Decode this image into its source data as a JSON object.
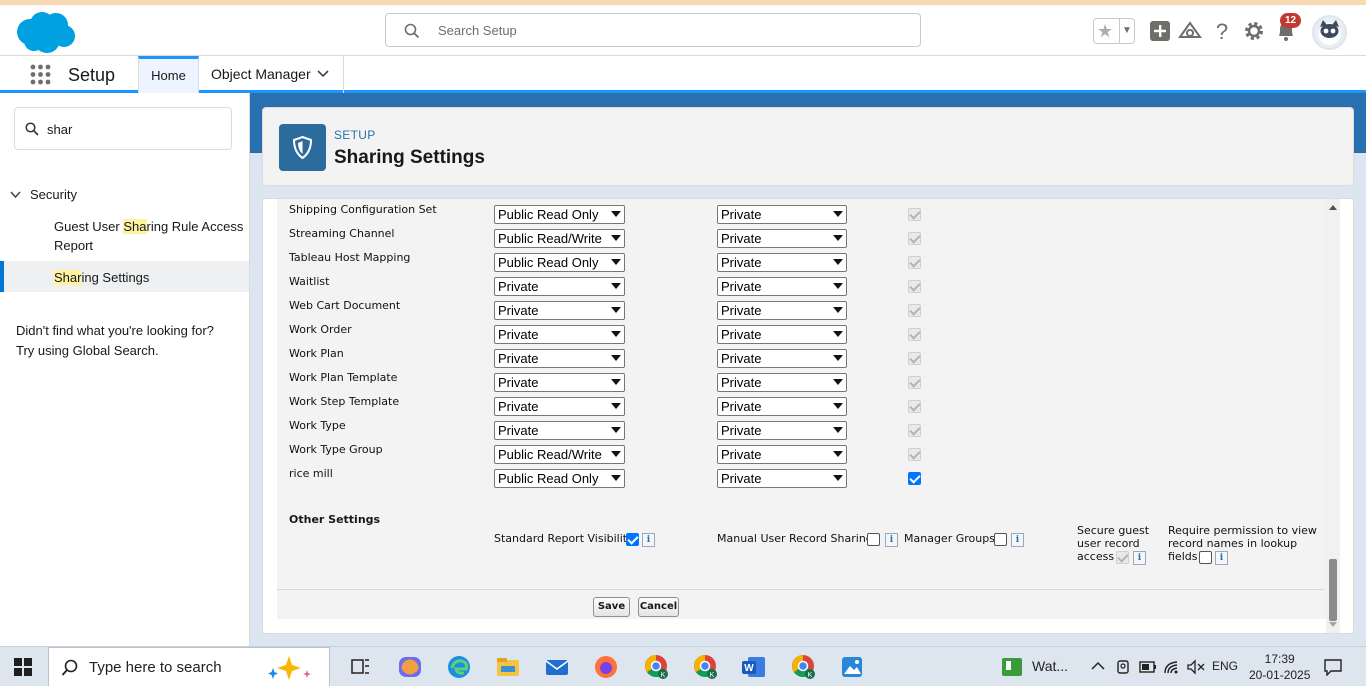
{
  "header": {
    "search_placeholder": "Search Setup",
    "notifications_count": "12"
  },
  "nav": {
    "app_title": "Setup",
    "tabs": [
      {
        "label": "Home"
      },
      {
        "label": "Object Manager"
      }
    ]
  },
  "sidebar": {
    "quick_find_value": "shar",
    "section": "Security",
    "items": [
      {
        "pre": "Guest User ",
        "hl": "Sha",
        "post": "ring Rule Access",
        "line2": "Report"
      },
      {
        "pre": "",
        "hl": "Shar",
        "post": "ing Settings"
      }
    ],
    "not_found_line1": "Didn't find what you're looking for?",
    "not_found_line2": "Try using Global Search."
  },
  "page": {
    "subtitle": "SETUP",
    "title": "Sharing Settings"
  },
  "rows": [
    {
      "object": "Shipping Configuration Set",
      "default_internal": "Public Read Only",
      "default_external": "Private",
      "grant_hierarchy": "disabled-checked"
    },
    {
      "object": "Streaming Channel",
      "default_internal": "Public Read/Write",
      "default_external": "Private",
      "grant_hierarchy": "disabled-checked"
    },
    {
      "object": "Tableau Host Mapping",
      "default_internal": "Public Read Only",
      "default_external": "Private",
      "grant_hierarchy": "disabled-checked"
    },
    {
      "object": "Waitlist",
      "default_internal": "Private",
      "default_external": "Private",
      "grant_hierarchy": "disabled-checked"
    },
    {
      "object": "Web Cart Document",
      "default_internal": "Private",
      "default_external": "Private",
      "grant_hierarchy": "disabled-checked"
    },
    {
      "object": "Work Order",
      "default_internal": "Private",
      "default_external": "Private",
      "grant_hierarchy": "disabled-checked"
    },
    {
      "object": "Work Plan",
      "default_internal": "Private",
      "default_external": "Private",
      "grant_hierarchy": "disabled-checked"
    },
    {
      "object": "Work Plan Template",
      "default_internal": "Private",
      "default_external": "Private",
      "grant_hierarchy": "disabled-checked"
    },
    {
      "object": "Work Step Template",
      "default_internal": "Private",
      "default_external": "Private",
      "grant_hierarchy": "disabled-checked"
    },
    {
      "object": "Work Type",
      "default_internal": "Private",
      "default_external": "Private",
      "grant_hierarchy": "disabled-checked"
    },
    {
      "object": "Work Type Group",
      "default_internal": "Public Read/Write",
      "default_external": "Private",
      "grant_hierarchy": "disabled-checked"
    },
    {
      "object": "rice mill",
      "default_internal": "Public Read Only",
      "default_external": "Private",
      "grant_hierarchy": "checked"
    }
  ],
  "other_settings": {
    "heading": "Other Settings",
    "standard_report_visibility": "Standard Report Visibility",
    "manual_user_record_sharing": "Manual User Record Sharing",
    "manager_groups": "Manager Groups",
    "secure_guest_line1": "Secure guest",
    "secure_guest_line2": "user record",
    "secure_guest_line3": "access",
    "require_perm_line1": "Require permission to view",
    "require_perm_line2": "record names in lookup",
    "require_perm_line3": "fields",
    "info_glyph": "i"
  },
  "buttons": {
    "save": "Save",
    "cancel": "Cancel"
  },
  "taskbar": {
    "search_placeholder": "Type here to search",
    "weather": "Wat...",
    "language": "ENG",
    "time": "17:39",
    "date": "20-01-2025"
  },
  "colors": {
    "brand": "#0176d3",
    "header_band": "#2a6fb0",
    "checkbox_on": "#0075ff"
  }
}
